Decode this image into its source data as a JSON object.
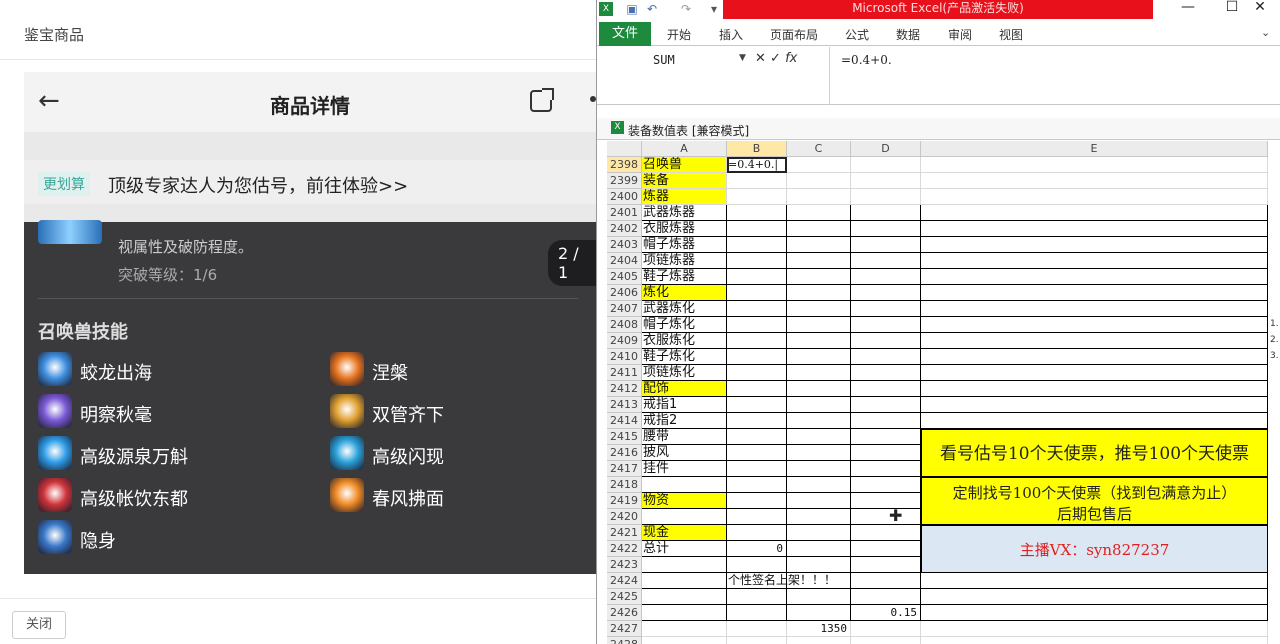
{
  "left": {
    "header_title": "鉴宝商品",
    "nav_title": "商品详情",
    "banner_tag": "更划算",
    "banner_text": "顶级专家达人为您估号，前往体验>>",
    "pager": "2 / 1",
    "desc_line": "视属性及破防程度。",
    "breakthrough": "突破等级：1/6",
    "skills_title": "召唤兽技能",
    "skills": [
      {
        "name": "蛟龙出海",
        "color": "#3f8fe0"
      },
      {
        "name": "涅槃",
        "color": "#e8741f"
      },
      {
        "name": "明察秋毫",
        "color": "#7a5ad6"
      },
      {
        "name": "双管齐下",
        "color": "#e0a030"
      },
      {
        "name": "高级源泉万斛",
        "color": "#2f9de8"
      },
      {
        "name": "高级闪现",
        "color": "#2aa0d8"
      },
      {
        "name": "高级帐饮东都",
        "color": "#d0343a"
      },
      {
        "name": "春风拂面",
        "color": "#f08a24"
      },
      {
        "name": "隐身",
        "color": "#3a78c8"
      }
    ],
    "close_button": "关闭"
  },
  "excel": {
    "window_title": "Microsoft Excel(产品激活失败)",
    "ribbon_tabs": [
      "开始",
      "插入",
      "页面布局",
      "公式",
      "数据",
      "审阅",
      "视图"
    ],
    "file_tab": "文件",
    "name_box": "SUM",
    "formula": "=0.4+0.",
    "workbook_title": "装备数值表  [兼容模式]",
    "columns": [
      "A",
      "B",
      "C",
      "D",
      "E"
    ],
    "rows": [
      {
        "n": "2398",
        "a": "召唤兽",
        "yellow": true,
        "b": "=0.4+0.|"
      },
      {
        "n": "2399",
        "a": "装备",
        "yellow": true
      },
      {
        "n": "2400",
        "a": "炼器",
        "yellow": true
      },
      {
        "n": "2401",
        "a": "武器炼器"
      },
      {
        "n": "2402",
        "a": "衣服炼器"
      },
      {
        "n": "2403",
        "a": "帽子炼器"
      },
      {
        "n": "2404",
        "a": "项链炼器"
      },
      {
        "n": "2405",
        "a": "鞋子炼器"
      },
      {
        "n": "2406",
        "a": "炼化",
        "yellow": true
      },
      {
        "n": "2407",
        "a": "武器炼化"
      },
      {
        "n": "2408",
        "a": "帽子炼化"
      },
      {
        "n": "2409",
        "a": "衣服炼化"
      },
      {
        "n": "2410",
        "a": "鞋子炼化"
      },
      {
        "n": "2411",
        "a": "项链炼化"
      },
      {
        "n": "2412",
        "a": "配饰",
        "yellow": true
      },
      {
        "n": "2413",
        "a": "戒指1"
      },
      {
        "n": "2414",
        "a": "戒指2"
      },
      {
        "n": "2415",
        "a": "腰带"
      },
      {
        "n": "2416",
        "a": "披风"
      },
      {
        "n": "2417",
        "a": "挂件"
      },
      {
        "n": "2418",
        "a": ""
      },
      {
        "n": "2419",
        "a": "物资",
        "yellow": true
      },
      {
        "n": "2420",
        "a": ""
      },
      {
        "n": "2421",
        "a": "现金",
        "yellow": true
      },
      {
        "n": "2422",
        "a": "总计",
        "b": "0"
      },
      {
        "n": "2423",
        "a": ""
      },
      {
        "n": "2424",
        "a": "",
        "b": "个性签名上架！！！"
      },
      {
        "n": "2425",
        "a": ""
      },
      {
        "n": "2426",
        "a": "",
        "d": "0.15"
      },
      {
        "n": "2427",
        "a": "",
        "c": "1350"
      },
      {
        "n": "2428",
        "a": ""
      }
    ],
    "edge_numbers": [
      "1.",
      "2.",
      "3."
    ],
    "promo1": "看号估号10个天使票，推号100个天使票",
    "promo2_line1": "定制找号100个天使票（找到包满意为止）",
    "promo2_line2": "后期包售后",
    "promo3": "主播VX：syn827237"
  }
}
